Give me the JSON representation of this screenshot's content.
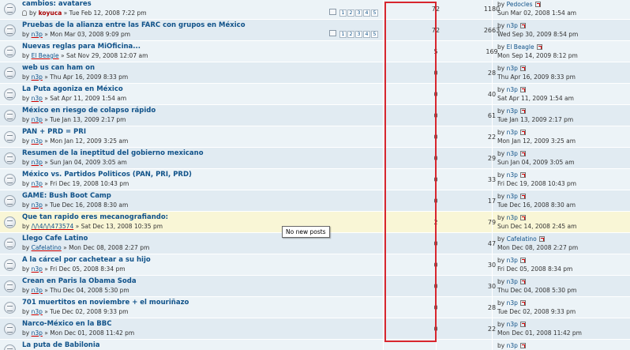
{
  "topics": [
    {
      "title": "cambios: avatares",
      "by": "by",
      "author": "koyuca",
      "author_bold": true,
      "attach": true,
      "date": "» Tue Feb 12, 2008 7:22 pm",
      "pages": [
        "1",
        "2",
        "3",
        "4",
        "5"
      ],
      "replies": "72",
      "views": "1180",
      "last_by": "by",
      "last_user": "Pedocles",
      "last_date": "Sun Mar 02, 2008 1:54 am"
    },
    {
      "title": "Pruebas de la alianza entre las FARC con grupos en México",
      "by": "by",
      "author": "n3p",
      "date": "» Mon Mar 03, 2008 9:09 pm",
      "pages": [
        "1",
        "2",
        "3",
        "4",
        "5"
      ],
      "replies": "72",
      "views": "2663",
      "last_by": "by",
      "last_user": "n3p",
      "last_date": "Wed Sep 30, 2009 8:54 pm"
    },
    {
      "title": "Nuevas reglas para MiOficina...",
      "by": "by",
      "author": "El Beagle",
      "date": "» Sat Nov 29, 2008 12:07 am",
      "replies": "5",
      "views": "169",
      "last_by": "by",
      "last_user": "El Beagle",
      "last_date": "Mon Sep 14, 2009 8:12 pm"
    },
    {
      "title": "web us can ham on",
      "by": "by",
      "author": "n3p",
      "date": "» Thu Apr 16, 2009 8:33 pm",
      "replies": "0",
      "views": "28",
      "last_by": "by",
      "last_user": "n3p",
      "last_date": "Thu Apr 16, 2009 8:33 pm"
    },
    {
      "title": "La Puta agoniza en México",
      "by": "by",
      "author": "n3p",
      "date": "» Sat Apr 11, 2009 1:54 am",
      "replies": "0",
      "views": "40",
      "last_by": "by",
      "last_user": "n3p",
      "last_date": "Sat Apr 11, 2009 1:54 am"
    },
    {
      "title": "México en riesgo de colapso rápido",
      "by": "by",
      "author": "n3p",
      "date": "» Tue Jan 13, 2009 2:17 pm",
      "replies": "0",
      "views": "61",
      "last_by": "by",
      "last_user": "n3p",
      "last_date": "Tue Jan 13, 2009 2:17 pm"
    },
    {
      "title": "PAN + PRD = PRI",
      "by": "by",
      "author": "n3p",
      "date": "» Mon Jan 12, 2009 3:25 am",
      "replies": "0",
      "views": "22",
      "last_by": "by",
      "last_user": "n3p",
      "last_date": "Mon Jan 12, 2009 3:25 am"
    },
    {
      "title": "Resumen de la ineptitud del gobierno mexicano",
      "by": "by",
      "author": "n3p",
      "date": "» Sun Jan 04, 2009 3:05 am",
      "replies": "0",
      "views": "29",
      "last_by": "by",
      "last_user": "n3p",
      "last_date": "Sun Jan 04, 2009 3:05 am"
    },
    {
      "title": "México vs. Partidos Politicos (PAN, PRI, PRD)",
      "by": "by",
      "author": "n3p",
      "date": "» Fri Dec 19, 2008 10:43 pm",
      "replies": "0",
      "views": "33",
      "last_by": "by",
      "last_user": "n3p",
      "last_date": "Fri Dec 19, 2008 10:43 pm"
    },
    {
      "title": "GAME: Bush Boot Camp",
      "by": "by",
      "author": "n3p",
      "date": "» Tue Dec 16, 2008 8:30 am",
      "replies": "0",
      "views": "17",
      "last_by": "by",
      "last_user": "n3p",
      "last_date": "Tue Dec 16, 2008 8:30 am"
    },
    {
      "title": "Que tan rapido eres mecanografiando:",
      "by": "by",
      "author": "/\\/\\4/\\/\\473574",
      "date": "» Sat Dec 13, 2008 10:35 pm",
      "replies": "2",
      "views": "79",
      "last_by": "by",
      "last_user": "n3p",
      "last_date": "Sun Dec 14, 2008 2:45 am",
      "highlight": true
    },
    {
      "title": "Llego Cafe Latino",
      "by": "by",
      "author": "Cafelatino",
      "date": "» Mon Dec 08, 2008 2:27 pm",
      "replies": "0",
      "views": "47",
      "last_by": "by",
      "last_user": "Cafelatino",
      "last_date": "Mon Dec 08, 2008 2:27 pm"
    },
    {
      "title": "A la cárcel por cachetear a su hijo",
      "by": "by",
      "author": "n3p",
      "date": "» Fri Dec 05, 2008 8:34 pm",
      "replies": "0",
      "views": "30",
      "last_by": "by",
      "last_user": "n3p",
      "last_date": "Fri Dec 05, 2008 8:34 pm"
    },
    {
      "title": "Crean en Paris la Obama Soda",
      "by": "by",
      "author": "n3p",
      "date": "» Thu Dec 04, 2008 5:30 pm",
      "replies": "0",
      "views": "30",
      "last_by": "by",
      "last_user": "n3p",
      "last_date": "Thu Dec 04, 2008 5:30 pm"
    },
    {
      "title": "701 muertitos en noviembre + el mouriñazo",
      "by": "by",
      "author": "n3p",
      "date": "» Tue Dec 02, 2008 9:33 pm",
      "replies": "0",
      "views": "28",
      "last_by": "by",
      "last_user": "n3p",
      "last_date": "Tue Dec 02, 2008 9:33 pm"
    },
    {
      "title": "Narco-México en la BBC",
      "by": "by",
      "author": "n3p",
      "date": "» Mon Dec 01, 2008 11:42 pm",
      "replies": "0",
      "views": "22",
      "last_by": "by",
      "last_user": "n3p",
      "last_date": "Mon Dec 01, 2008 11:42 pm"
    },
    {
      "title": "La puta de Babilonia",
      "by": "",
      "author": "",
      "date": "",
      "replies": "",
      "views": "",
      "last_by": "by",
      "last_user": "n3p",
      "last_date": ""
    }
  ],
  "tooltip": "No new posts",
  "colors": {
    "highlight_box": "#d8262e",
    "link": "#105289",
    "row_a": "#ecf3f7",
    "row_b": "#e1ebf2",
    "row_hover": "#f9f6d6"
  }
}
